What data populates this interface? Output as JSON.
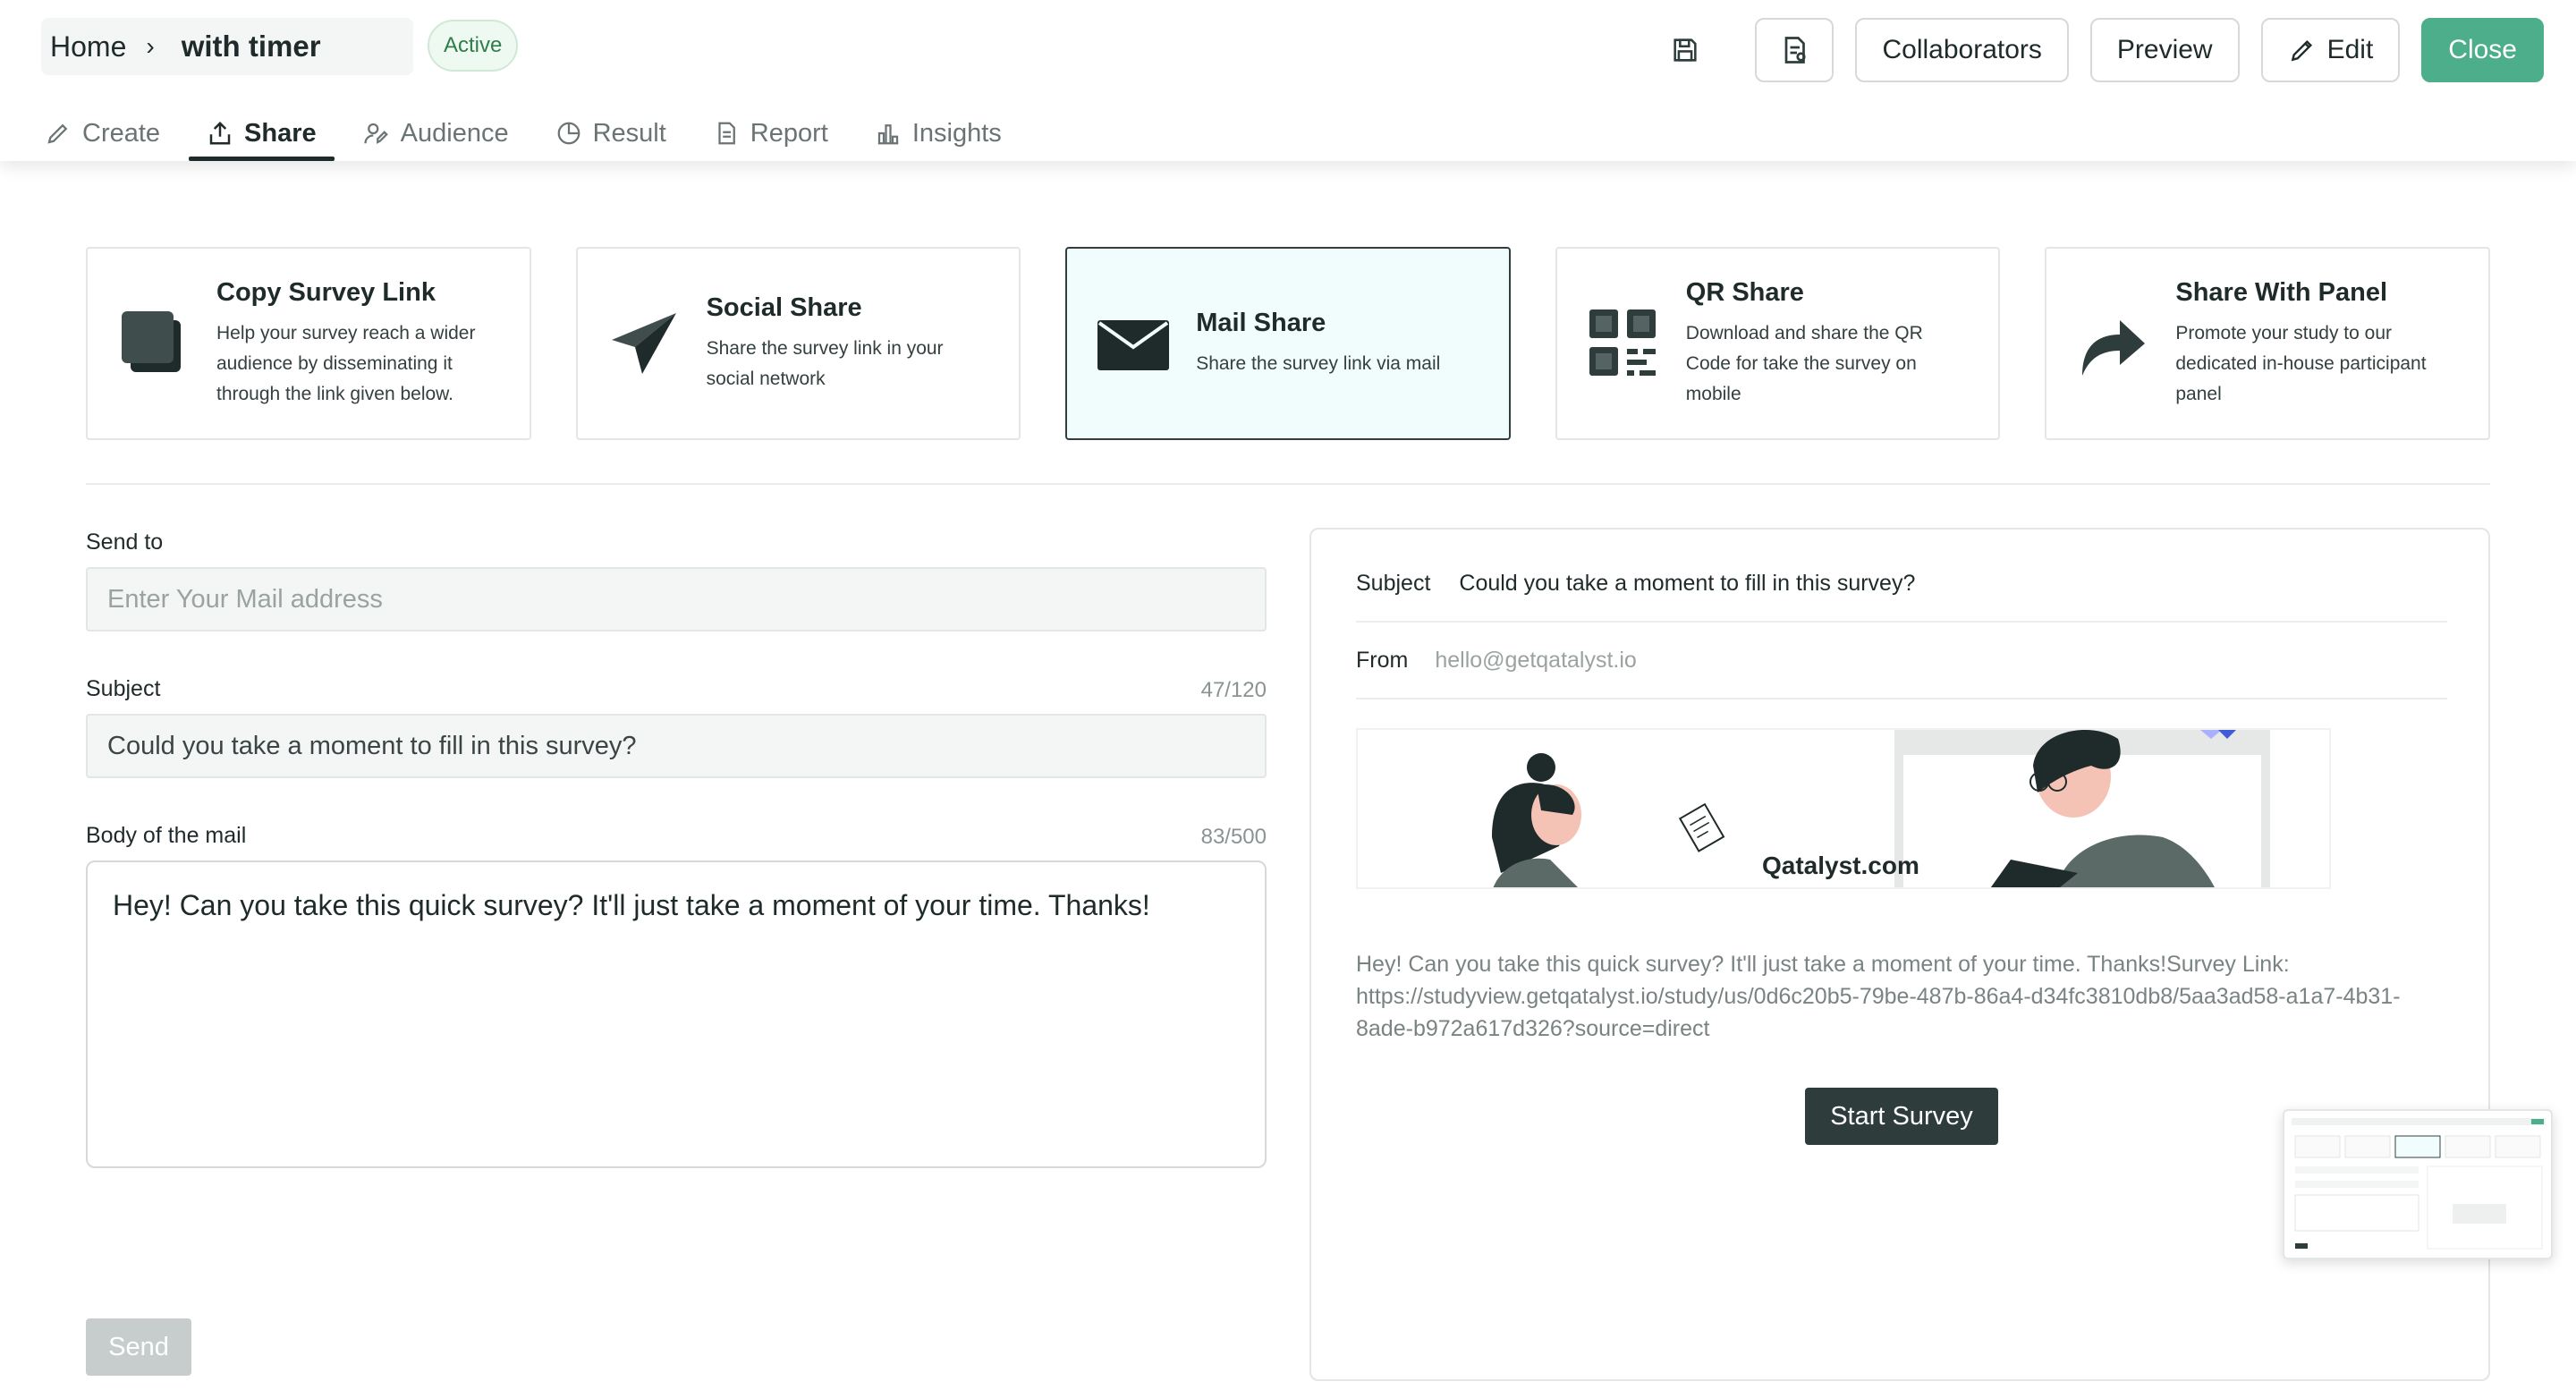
{
  "breadcrumb": {
    "home": "Home",
    "separator": "›",
    "title": "with timer"
  },
  "status_badge": "Active",
  "header_actions": {
    "collaborators": "Collaborators",
    "preview": "Preview",
    "edit": "Edit",
    "close": "Close"
  },
  "tabs": [
    {
      "label": "Create",
      "icon": "pencil-icon"
    },
    {
      "label": "Share",
      "icon": "share-icon",
      "active": true
    },
    {
      "label": "Audience",
      "icon": "audience-icon"
    },
    {
      "label": "Result",
      "icon": "pie-chart-icon"
    },
    {
      "label": "Report",
      "icon": "document-icon"
    },
    {
      "label": "Insights",
      "icon": "bar-chart-icon"
    }
  ],
  "share_cards": [
    {
      "title": "Copy Survey Link",
      "desc": "Help your survey reach a wider audience by disseminating it through the link given below.",
      "icon": "copy-icon"
    },
    {
      "title": "Social Share",
      "desc": "Share the survey link in your social network",
      "icon": "paper-plane-icon"
    },
    {
      "title": "Mail Share",
      "desc": "Share the survey link via mail",
      "icon": "envelope-icon",
      "selected": true
    },
    {
      "title": "QR Share",
      "desc": "Download and share the QR Code for take the survey on mobile",
      "icon": "qr-code-icon"
    },
    {
      "title": "Share With Panel",
      "desc": "Promote your study to our dedicated in-house participant panel",
      "icon": "forward-arrow-icon"
    }
  ],
  "form": {
    "send_to_label": "Send to",
    "send_to_placeholder": "Enter Your Mail address",
    "subject_label": "Subject",
    "subject_counter": "47/120",
    "subject_value": "Could you take a moment to fill in this survey?",
    "body_label": "Body of the mail",
    "body_counter": "83/500",
    "body_value": "Hey! Can you take this quick survey? It'll just take a moment of your time. Thanks!",
    "send_button": "Send"
  },
  "preview": {
    "subject_key": "Subject",
    "subject_value": "Could you take a moment to fill in this survey?",
    "from_key": "From",
    "from_value": "hello@getqatalyst.io",
    "brand": "Qatalyst.com",
    "body": "Hey! Can you take this quick survey? It'll just take a moment of your time. Thanks!Survey Link: https://studyview.getqatalyst.io/study/us/0d6c20b5-79be-487b-86a4-d34fc3810db8/5aa3ad58-a1a7-4b31-8ade-b972a617d326?source=direct",
    "start_button": "Start Survey"
  },
  "colors": {
    "accent": "#4cae8a",
    "dark": "#2e3c3c",
    "selected_bg": "#f1fcfc"
  }
}
